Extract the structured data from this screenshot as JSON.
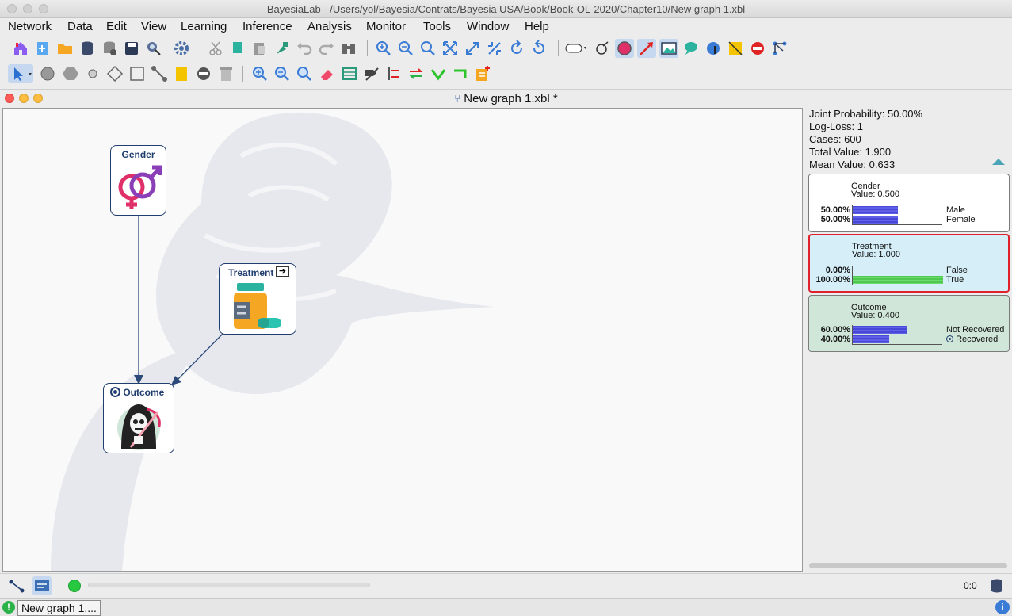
{
  "window": {
    "title": "BayesiaLab - /Users/yol/Bayesia/Contrats/Bayesia USA/Book/Book-OL-2020/Chapter10/New graph 1.xbl"
  },
  "menu": [
    "Network",
    "Data",
    "Edit",
    "View",
    "Learning",
    "Inference",
    "Analysis",
    "Monitor",
    "Tools",
    "Window",
    "Help"
  ],
  "toolbar_top": [
    "home-icon",
    "new-network-icon",
    "open-folder-icon",
    "database-icon",
    "database-export-icon",
    "save-icon",
    "inspect-icon",
    "settings-gear-icon",
    "cut-icon",
    "copy-icon",
    "paste-icon",
    "format-brush-icon",
    "undo-icon",
    "redo-icon",
    "binoculars-icon",
    "zoom-in-icon",
    "zoom-out-icon",
    "zoom-fit-icon",
    "fit-window-icon",
    "expand-icon",
    "shrink-icon",
    "rotate-left-icon",
    "rotate-right-icon",
    "node-style-icon",
    "node-display-icon",
    "monitor-circle-icon",
    "arc-icon",
    "image-icon",
    "comment-icon",
    "info-globe-icon",
    "note-icon",
    "delete-forbid-icon",
    "network-graph-icon"
  ],
  "toolbar_bottom": [
    "selection-arrow-icon",
    "circle-node-icon",
    "hexagon-node-icon",
    "small-node-icon",
    "decision-node-icon",
    "square-node-icon",
    "arc-tool-icon",
    "note-tool-icon",
    "remove-icon",
    "trash-icon",
    "zoom-in-select-icon",
    "zoom-out-select-icon",
    "zoom-fit-select-icon",
    "eraser-icon",
    "table-icon",
    "disconnect-icon",
    "align-icon",
    "swap-icon",
    "check-icon",
    "corner-icon",
    "add-note-icon"
  ],
  "document": {
    "title": "New graph 1.xbl *"
  },
  "nodes": {
    "gender": {
      "label": "Gender"
    },
    "treatment": {
      "label": "Treatment"
    },
    "outcome": {
      "label": "Outcome"
    }
  },
  "stats": {
    "joint": "Joint Probability: 50.00%",
    "logloss": "Log-Loss: 1",
    "cases": "Cases: 600",
    "total": "Total Value: 1.900",
    "mean": "Mean Value: 0.633"
  },
  "monitors": {
    "gender": {
      "name": "Gender",
      "value": "Value: 0.500",
      "states": [
        {
          "pct": "50.00%",
          "label": "Male",
          "prob": 0.5
        },
        {
          "pct": "50.00%",
          "label": "Female",
          "prob": 0.5
        }
      ]
    },
    "treatment": {
      "name": "Treatment",
      "value": "Value: 1.000",
      "states": [
        {
          "pct": "0.00%",
          "label": "False",
          "prob": 0.0
        },
        {
          "pct": "100.00%",
          "label": "True",
          "prob": 1.0
        }
      ]
    },
    "outcome": {
      "name": "Outcome",
      "value": "Value: 0.400",
      "states": [
        {
          "pct": "60.00%",
          "label": "Not Recovered",
          "prob": 0.6
        },
        {
          "pct": "40.00%",
          "label": "Recovered",
          "prob": 0.4
        }
      ]
    }
  },
  "colors": {
    "treatment_bg": "#d5eef8",
    "treatment_border": "#e0202a",
    "outcome_bg": "#cfe6d8",
    "bar_blue": "#4444dd",
    "bar_green": "#55cc55"
  },
  "status": {
    "counter": "0:0"
  },
  "taskbar": {
    "item": "New graph 1...."
  }
}
